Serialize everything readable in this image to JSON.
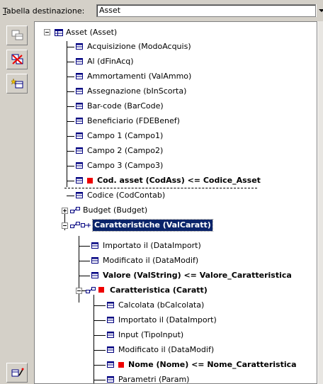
{
  "header": {
    "label_prefix": "T",
    "label_rest": "abella destinazione:",
    "table_value": "Asset"
  },
  "toolbar": {
    "buttons": [
      "table-copy-icon",
      "table-link-delete-icon",
      "field-add-icon",
      "mapping-wizard-icon"
    ]
  },
  "tree": {
    "root": {
      "label": "Asset (Asset)",
      "icon": "table-icon"
    },
    "fields": [
      {
        "label": "Acquisizione (ModoAcquis)"
      },
      {
        "label": "Al (dFinAcq)"
      },
      {
        "label": "Ammortamenti (ValAmmo)"
      },
      {
        "label": "Assegnazione (bInScorta)"
      },
      {
        "label": "Bar-code (BarCode)"
      },
      {
        "label": "Beneficiario (FDEBenef)"
      },
      {
        "label": "Campo 1 (Campo1)"
      },
      {
        "label": "Campo 2 (Campo2)"
      },
      {
        "label": "Campo 3 (Campo3)"
      },
      {
        "label": "Cod. asset (CodAss)  <=  Codice_Asset",
        "bold": true,
        "key": true
      },
      {
        "label": "Codice (CodContab)"
      }
    ],
    "links": [
      {
        "label": "Budget (Budget)"
      },
      {
        "label": "Caratteristiche (ValCaratt)",
        "selected": true
      }
    ],
    "caratt_fields": [
      {
        "label": "Importato il (DataImport)"
      },
      {
        "label": "Modificato il (DataModif)"
      },
      {
        "label": "Valore (ValString)  <=  Valore_Caratteristica",
        "bold": true
      }
    ],
    "caratt_link": {
      "label": "Caratteristica (Caratt)",
      "bold": true,
      "key": true
    },
    "caratt_sub_fields": [
      {
        "label": "Calcolata (bCalcolata)"
      },
      {
        "label": "Importato il (DataImport)"
      },
      {
        "label": "Input (TipoInput)"
      },
      {
        "label": "Modificato il (DataModif)"
      },
      {
        "label": "Nome (Nome)  <=  Nome_Caratteristica",
        "bold": true,
        "key": true
      },
      {
        "label": "Parametri (Param)"
      }
    ]
  },
  "colors": {
    "selection": "#0a246a",
    "key_marker": "#e00000",
    "panel_bg": "#d4d0c8"
  }
}
